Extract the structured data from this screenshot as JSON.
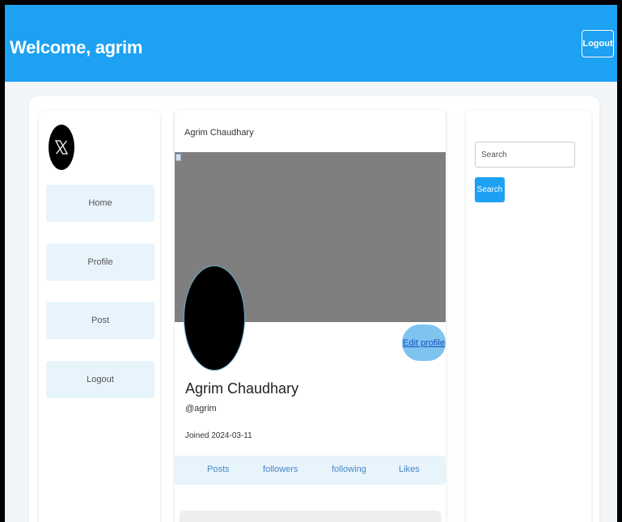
{
  "header": {
    "welcome_text": "Welcome, agrim",
    "logout_label": "Logout"
  },
  "sidebar": {
    "logo_icon": "x-logo-icon",
    "items": [
      {
        "label": "Home"
      },
      {
        "label": "Profile"
      },
      {
        "label": "Post"
      },
      {
        "label": "Logout"
      }
    ]
  },
  "profile": {
    "title": "Agrim Chaudhary",
    "banner_icon": "broken-image-icon",
    "edit_label": "Edit profile",
    "name": "Agrim Chaudhary",
    "handle": "@agrim",
    "joined": "Joined 2024-03-11",
    "tabs": [
      {
        "label": "Posts"
      },
      {
        "label": "followers"
      },
      {
        "label": "following"
      },
      {
        "label": "Likes"
      }
    ]
  },
  "search": {
    "placeholder": "Search",
    "value": "",
    "button_label": "Search"
  },
  "colors": {
    "brand": "#1da1f2",
    "nav_bg": "#e8f4fc",
    "banner": "#7f7f7f",
    "edit_button": "#7fc3ef"
  }
}
